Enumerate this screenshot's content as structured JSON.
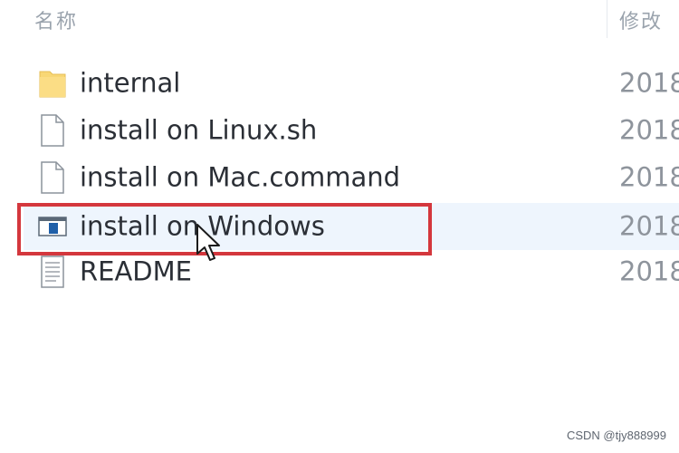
{
  "header": {
    "name_label": "名称",
    "modified_label": "修改"
  },
  "files": [
    {
      "name": "internal",
      "date": "2018",
      "icon": "folder-icon"
    },
    {
      "name": "install on Linux.sh",
      "date": "2018",
      "icon": "document-icon"
    },
    {
      "name": "install on Mac.command",
      "date": "2018",
      "icon": "document-icon"
    },
    {
      "name": "install on Windows",
      "date": "2018",
      "icon": "application-icon",
      "selected": true
    },
    {
      "name": "README",
      "date": "2018",
      "icon": "text-file-icon"
    }
  ],
  "colors": {
    "highlight_box": "#d4373d",
    "selection": "#eef5fd",
    "folder": "#f8d775"
  },
  "watermark": "CSDN @tjy888999"
}
